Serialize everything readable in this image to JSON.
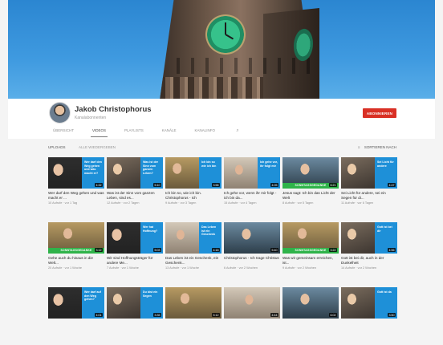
{
  "channel": {
    "name": "Jakob Christophorus",
    "subscribers": "Kanalabonnenten",
    "subscribe_label": "ABONNIEREN"
  },
  "tabs": [
    {
      "label": "Übersicht",
      "active": false
    },
    {
      "label": "Videos",
      "active": true
    },
    {
      "label": "Playlists",
      "active": false
    },
    {
      "label": "Kanäle",
      "active": false
    },
    {
      "label": "Kanalinfo",
      "active": false
    }
  ],
  "toolbar": {
    "uploads_label": "Uploads",
    "play_all_label": "Alle wiedergeben",
    "sort_label": "Sortieren nach"
  },
  "colors": {
    "accent_blue": "#1e90d8",
    "subscribe_red": "#d93025",
    "green_bar": "#2fb34a"
  },
  "videos": [
    {
      "overlay": "Wer darf den Weg gehen und was macht er?",
      "duration": "4:32",
      "title": "Wer darf den Weg gehen und was macht er ...",
      "meta": "10 Aufrufe · vor 1 Tag",
      "green": ""
    },
    {
      "overlay": "Was ist der Sinn vom ganzen Leben?",
      "duration": "5:10",
      "title": "Was ist der Sinn vom ganzen Leben, sind es...",
      "meta": "12 Aufrufe · vor 2 Tagen",
      "green": ""
    },
    {
      "overlay": "Ich bin so wie ich bin",
      "duration": "3:58",
      "title": "Ich bin so, wie ich bin. Christophorus - Ich",
      "meta": "9 Aufrufe · vor 3 Tagen",
      "green": ""
    },
    {
      "overlay": "Ich gehe vor, ihr folgt mir",
      "duration": "4:05",
      "title": "Ich gehe vor, wenn ihr mir folgt - ich bin da...",
      "meta": "15 Aufrufe · vor 4 Tagen",
      "green": ""
    },
    {
      "overlay": "",
      "duration": "6:21",
      "title": "Jesus sagt: Ich bin das Licht der Welt",
      "meta": "8 Aufrufe · vor 5 Tagen",
      "green": "SONNTAGSGEDANKE"
    },
    {
      "overlay": "Sei Licht für andere",
      "duration": "4:47",
      "title": "Sei Licht für andere, sei ein Segen für di...",
      "meta": "11 Aufrufe · vor 6 Tagen",
      "green": ""
    },
    {
      "overlay": "",
      "duration": "3:12",
      "title": "Gehe auch du hinaus in die Welt...",
      "meta": "20 Aufrufe · vor 1 Woche",
      "green": "SONNTAGSGEDANKE"
    },
    {
      "overlay": "Wer hat Hoffnung?",
      "duration": "5:03",
      "title": "Wir sind Hoffnungsträger für andere Me...",
      "meta": "7 Aufrufe · vor 1 Woche",
      "green": ""
    },
    {
      "overlay": "Das Leben ist ein Geschenk",
      "duration": "4:18",
      "title": "Das Leben ist ein Geschenk, ein Geschenk...",
      "meta": "13 Aufrufe · vor 1 Woche",
      "green": ""
    },
    {
      "overlay": "",
      "duration": "5:40",
      "title": "Christophorus - Ich trage Christus",
      "meta": "6 Aufrufe · vor 2 Wochen",
      "green": ""
    },
    {
      "overlay": "",
      "duration": "3:22",
      "title": "Was wir gemeinsam erreichen, ist...",
      "meta": "9 Aufrufe · vor 2 Wochen",
      "green": "SONNTAGSGEDANKE"
    },
    {
      "overlay": "Gott ist bei dir",
      "duration": "4:56",
      "title": "Gott ist bei dir, auch in der Dunkelheit",
      "meta": "14 Aufrufe · vor 2 Wochen",
      "green": ""
    },
    {
      "overlay": "Wer darf auf den Weg gehen?",
      "duration": "4:01",
      "title": "",
      "meta": "",
      "green": ""
    },
    {
      "overlay": "Du bist ein Segen",
      "duration": "3:35",
      "title": "",
      "meta": "",
      "green": ""
    },
    {
      "overlay": "",
      "duration": "5:12",
      "title": "",
      "meta": "",
      "green": ""
    },
    {
      "overlay": "",
      "duration": "4:44",
      "title": "",
      "meta": "",
      "green": ""
    },
    {
      "overlay": "",
      "duration": "6:02",
      "title": "",
      "meta": "",
      "green": ""
    },
    {
      "overlay": "Gott ist da",
      "duration": "3:50",
      "title": "",
      "meta": "",
      "green": ""
    }
  ]
}
